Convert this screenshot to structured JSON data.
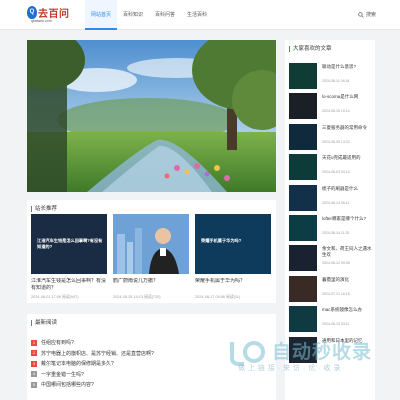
{
  "brand": {
    "badge": "Q",
    "name": "去百问",
    "url": "qbaiwen.com"
  },
  "nav": {
    "items": [
      {
        "label": "网站首页",
        "active": true
      },
      {
        "label": "百科知识",
        "active": false
      },
      {
        "label": "百科问答",
        "active": false
      },
      {
        "label": "生活百科",
        "active": false
      }
    ]
  },
  "search": {
    "label": "搜索"
  },
  "recommend": {
    "title": "站长推荐",
    "cards": [
      {
        "thumb_text": "江淮汽车生钱是怎么回事啊?有没有知道的?",
        "title": "江淮汽车生钱是怎么回事啊？有没有知道的？",
        "date": "2024-08-01 17:06",
        "views": "阅读(947)"
      },
      {
        "thumb_text": "",
        "title": "鹤广蔚雨说几万撤？",
        "date": "2024-08-25 14:13",
        "views": "阅读(720)"
      },
      {
        "thumb_text": "荣耀手机属于华为吗?",
        "title": "荣耀手机属于华为吗？",
        "date": "2024-08-17 09:56",
        "views": "阅读(11)"
      }
    ]
  },
  "recent": {
    "title": "最新阅读",
    "items": [
      {
        "num": "1",
        "text": "任组应有到吗?"
      },
      {
        "num": "2",
        "text": "苏宁电器上的旗帜店、是苏宁经销、还是直营店啊?"
      },
      {
        "num": "3",
        "text": "戴尔笔记本电脑的保修期是多久?"
      },
      {
        "num": "4",
        "text": "一字重金错一生吗?"
      },
      {
        "num": "5",
        "text": "中国哪间包括哪些内容?"
      }
    ]
  },
  "sidebar": {
    "title": "大家喜欢的文章",
    "items": [
      {
        "text": "联动是什么意思?",
        "date": "2024-08-11 04:34",
        "thumb": ""
      },
      {
        "text": "lo-scoma是什么网",
        "date": "2024-08-15 10:14",
        "thumb": ""
      },
      {
        "text": "三菱服务器的常用命令",
        "date": "2024-08-05 13:32",
        "thumb": ""
      },
      {
        "text": "天花u完成最适用的",
        "date": "2024-08-03 04:14",
        "thumb": ""
      },
      {
        "text": "梳子的刷器是什么",
        "date": "2024-08-14 05:11",
        "thumb": ""
      },
      {
        "text": "lofter哪家是哪个什么?",
        "date": "2024-08-14 11:32",
        "thumb": ""
      },
      {
        "text": "余文和、荷王同人之遇水生欢",
        "date": "2024-08-12 09:08",
        "thumb": ""
      },
      {
        "text": "暮霭里的演化",
        "date": "2024-07-21 16:15",
        "thumb": ""
      },
      {
        "text": "mac系统镜像怎么办",
        "date": "2024-08-13 03:11",
        "thumb": ""
      },
      {
        "text": "通用和日本里的记忆",
        "date": "",
        "thumb": ""
      }
    ]
  },
  "watermark": {
    "text": "自动秒收录",
    "sub": "做 上 链 接 · 来 访 · 优 · 收 录"
  },
  "colors": {
    "accent": "#2d8cf0",
    "logo_red": "#c0392b",
    "badge_red": "#e74c3c"
  }
}
